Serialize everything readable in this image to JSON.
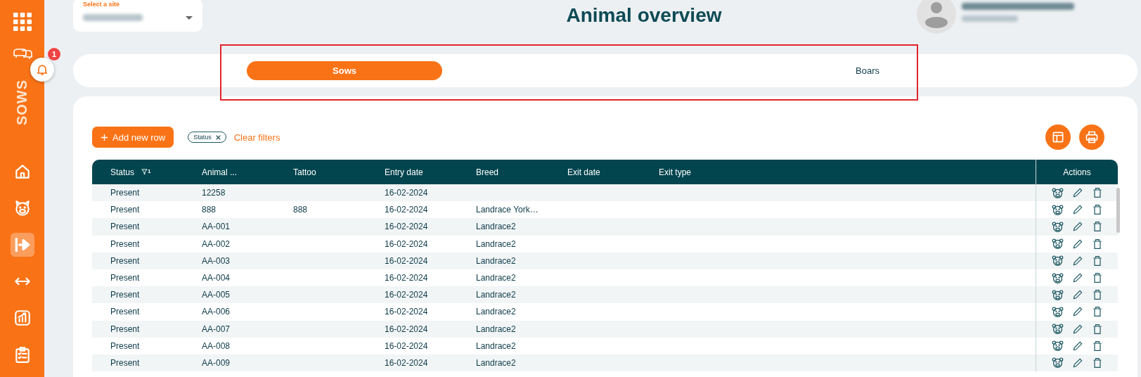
{
  "sidebar": {
    "app_label": "SOWS",
    "notification_count": "1",
    "items": [
      {
        "kind": "home",
        "selected": false
      },
      {
        "kind": "pig",
        "selected": false
      },
      {
        "kind": "exit",
        "selected": true
      },
      {
        "kind": "transfer",
        "selected": false
      },
      {
        "kind": "chart",
        "selected": false
      },
      {
        "kind": "clipboard",
        "selected": false
      }
    ]
  },
  "site_select": {
    "label": "Select a site"
  },
  "title": "Animal overview",
  "tabs": [
    {
      "label": "Sows",
      "selected": true
    },
    {
      "label": "Boars",
      "selected": false
    }
  ],
  "toolbar": {
    "add_button": "Add new row",
    "filter_chips": [
      {
        "label": "Status"
      }
    ],
    "clear_filters": "Clear filters"
  },
  "table": {
    "columns": [
      {
        "label": "Status",
        "filter_count": "1"
      },
      {
        "label": "Animal ..."
      },
      {
        "label": "Tattoo"
      },
      {
        "label": "Entry date"
      },
      {
        "label": "Breed"
      },
      {
        "label": "Exit date"
      },
      {
        "label": "Exit type"
      }
    ],
    "actions_label": "Actions",
    "rows": [
      [
        "Present",
        "12258",
        "",
        "16-02-2024",
        "",
        "",
        ""
      ],
      [
        "Present",
        "888",
        "888",
        "16-02-2024",
        "Landrace York…",
        "",
        ""
      ],
      [
        "Present",
        "AA-001",
        "",
        "16-02-2024",
        "Landrace2",
        "",
        ""
      ],
      [
        "Present",
        "AA-002",
        "",
        "16-02-2024",
        "Landrace2",
        "",
        ""
      ],
      [
        "Present",
        "AA-003",
        "",
        "16-02-2024",
        "Landrace2",
        "",
        ""
      ],
      [
        "Present",
        "AA-004",
        "",
        "16-02-2024",
        "Landrace2",
        "",
        ""
      ],
      [
        "Present",
        "AA-005",
        "",
        "16-02-2024",
        "Landrace2",
        "",
        ""
      ],
      [
        "Present",
        "AA-006",
        "",
        "16-02-2024",
        "Landrace2",
        "",
        ""
      ],
      [
        "Present",
        "AA-007",
        "",
        "16-02-2024",
        "Landrace2",
        "",
        ""
      ],
      [
        "Present",
        "AA-008",
        "",
        "16-02-2024",
        "Landrace2",
        "",
        ""
      ],
      [
        "Present",
        "AA-009",
        "",
        "16-02-2024",
        "Landrace2",
        "",
        ""
      ]
    ]
  }
}
